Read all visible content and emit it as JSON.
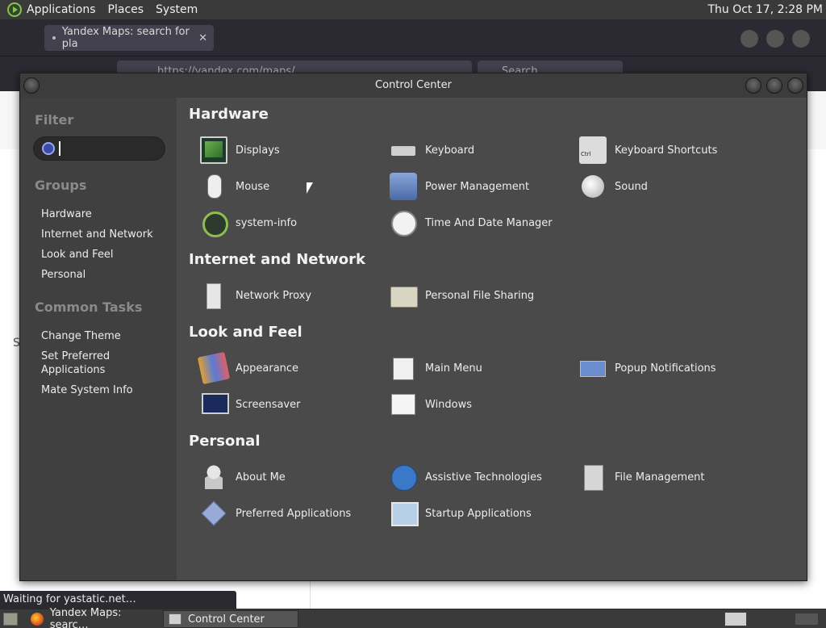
{
  "top_panel": {
    "menus": [
      "Applications",
      "Places",
      "System"
    ],
    "clock": "Thu Oct 17,  2:28 PM"
  },
  "browser": {
    "tab_title": "Yandex Maps: search for pla",
    "url": "https://yandex.com/maps/",
    "search_placeholder": "Search",
    "status": "Waiting for yastatic.net…",
    "page_letter": "S"
  },
  "control_center": {
    "title": "Control Center",
    "sidebar": {
      "filter_heading": "Filter",
      "filter_value": "",
      "groups_heading": "Groups",
      "groups": [
        "Hardware",
        "Internet and Network",
        "Look and Feel",
        "Personal"
      ],
      "tasks_heading": "Common Tasks",
      "tasks": [
        "Change Theme",
        "Set Preferred Applications",
        "Mate System Info"
      ]
    },
    "sections": [
      {
        "title": "Hardware",
        "items": [
          {
            "label": "Displays",
            "icon": "display-icon"
          },
          {
            "label": "Keyboard",
            "icon": "keyboard-icon"
          },
          {
            "label": "Keyboard Shortcuts",
            "icon": "keyboard-shortcuts-icon"
          },
          {
            "label": "Mouse",
            "icon": "mouse-icon"
          },
          {
            "label": "Power Management",
            "icon": "power-icon"
          },
          {
            "label": "Sound",
            "icon": "sound-icon"
          },
          {
            "label": "system-info",
            "icon": "system-info-icon"
          },
          {
            "label": "Time And Date Manager",
            "icon": "clock-icon"
          }
        ]
      },
      {
        "title": "Internet and Network",
        "items": [
          {
            "label": "Network Proxy",
            "icon": "network-proxy-icon"
          },
          {
            "label": "Personal File Sharing",
            "icon": "folder-share-icon"
          }
        ]
      },
      {
        "title": "Look and Feel",
        "items": [
          {
            "label": "Appearance",
            "icon": "appearance-icon"
          },
          {
            "label": "Main Menu",
            "icon": "main-menu-icon"
          },
          {
            "label": "Popup Notifications",
            "icon": "popup-icon"
          },
          {
            "label": "Screensaver",
            "icon": "screensaver-icon"
          },
          {
            "label": "Windows",
            "icon": "windows-icon"
          }
        ]
      },
      {
        "title": "Personal",
        "items": [
          {
            "label": "About Me",
            "icon": "about-me-icon"
          },
          {
            "label": "Assistive Technologies",
            "icon": "assistive-icon"
          },
          {
            "label": "File Management",
            "icon": "file-management-icon"
          },
          {
            "label": "Preferred Applications",
            "icon": "preferred-apps-icon"
          },
          {
            "label": "Startup Applications",
            "icon": "startup-icon"
          }
        ]
      }
    ]
  },
  "taskbar": {
    "tasks": [
      "Yandex Maps: searc…",
      "Control Center"
    ]
  }
}
